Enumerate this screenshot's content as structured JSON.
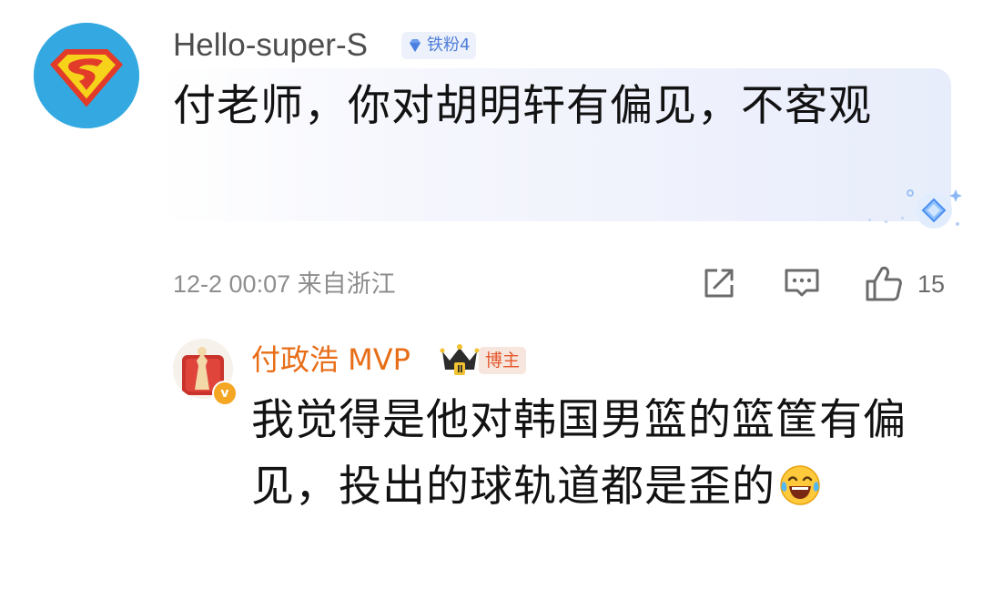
{
  "comment": {
    "username": "Hello-super-S",
    "fan_badge": "铁粉4",
    "text": "付老师，你对胡明轩有偏见，不客观",
    "meta": "12-2 00:07 来自浙江",
    "like_count": "15",
    "icons": [
      "superman-avatar",
      "diamond-badge-icon",
      "share-icon",
      "comment-icon",
      "like-icon",
      "gem-decoration-icon"
    ]
  },
  "reply": {
    "username": "付政浩 MVP",
    "author_badge": "博主",
    "text": "我觉得是他对韩国男篮的篮筐有偏见，投出的球轨道都是歪的",
    "emoji": "tears-of-joy-emoji",
    "icons": [
      "verified-v-icon",
      "crown-level-icon"
    ]
  },
  "colors": {
    "reply_username": "#e86d17",
    "author_badge_text": "#e5572c",
    "fan_badge_text": "#4f7fd8",
    "meta_text": "#8e8e8e",
    "avatar_bg": "#34a9e1"
  }
}
